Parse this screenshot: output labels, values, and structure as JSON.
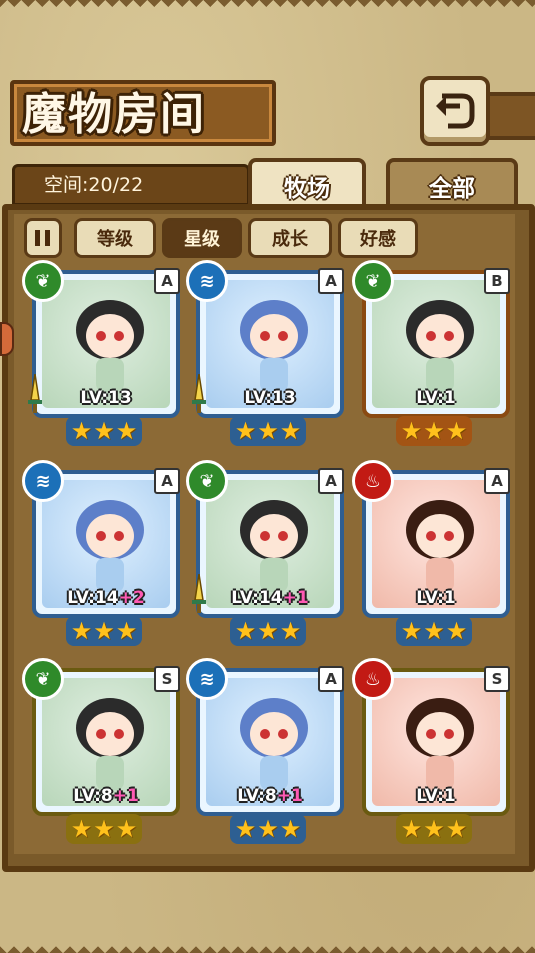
{
  "header": {
    "title": "魔物房间",
    "back_icon": "back-arrow-icon"
  },
  "storage": {
    "label": "空间:20/22"
  },
  "tabs": [
    {
      "label": "牧场",
      "active": true
    },
    {
      "label": "全部",
      "active": false
    }
  ],
  "sort": {
    "toggle_icon": "sort-toggle-icon",
    "buttons": [
      {
        "label": "等级",
        "active": false
      },
      {
        "label": "星级",
        "active": true
      },
      {
        "label": "成长",
        "active": false
      },
      {
        "label": "好感",
        "active": false
      }
    ]
  },
  "monsters": [
    {
      "element": "grass",
      "element_icon": "leaf-icon",
      "rank": "A",
      "level": "LV:13",
      "bonus": "",
      "stars": 3,
      "frame": "blue",
      "equip": true
    },
    {
      "element": "water",
      "element_icon": "water-wave-icon",
      "rank": "A",
      "level": "LV:13",
      "bonus": "",
      "stars": 3,
      "frame": "blue",
      "equip": true
    },
    {
      "element": "grass",
      "element_icon": "leaf-icon",
      "rank": "B",
      "level": "LV:1",
      "bonus": "",
      "stars": 3,
      "frame": "orange",
      "equip": false
    },
    {
      "element": "water",
      "element_icon": "water-wave-icon",
      "rank": "A",
      "level": "LV:14",
      "bonus": "+2",
      "stars": 3,
      "frame": "blue",
      "equip": false
    },
    {
      "element": "grass",
      "element_icon": "leaf-icon",
      "rank": "A",
      "level": "LV:14",
      "bonus": "+1",
      "stars": 3,
      "frame": "blue",
      "equip": true
    },
    {
      "element": "fire",
      "element_icon": "flame-icon",
      "rank": "A",
      "level": "LV:1",
      "bonus": "",
      "stars": 3,
      "frame": "blue",
      "equip": false
    },
    {
      "element": "grass",
      "element_icon": "leaf-icon",
      "rank": "S",
      "level": "LV:8",
      "bonus": "+1",
      "stars": 3,
      "frame": "yellow",
      "equip": false
    },
    {
      "element": "water",
      "element_icon": "water-wave-icon",
      "rank": "A",
      "level": "LV:8",
      "bonus": "+1",
      "stars": 3,
      "frame": "blue",
      "equip": false
    },
    {
      "element": "fire",
      "element_icon": "flame-icon",
      "rank": "S",
      "level": "LV:1",
      "bonus": "",
      "stars": 3,
      "frame": "yellow",
      "equip": false
    }
  ],
  "colors": {
    "frame_blue": "#2f5e91",
    "frame_orange": "#8a4a12",
    "frame_yellow": "#6a5a10",
    "star": "#ffc11c",
    "bonus": "#ff5ab4"
  }
}
